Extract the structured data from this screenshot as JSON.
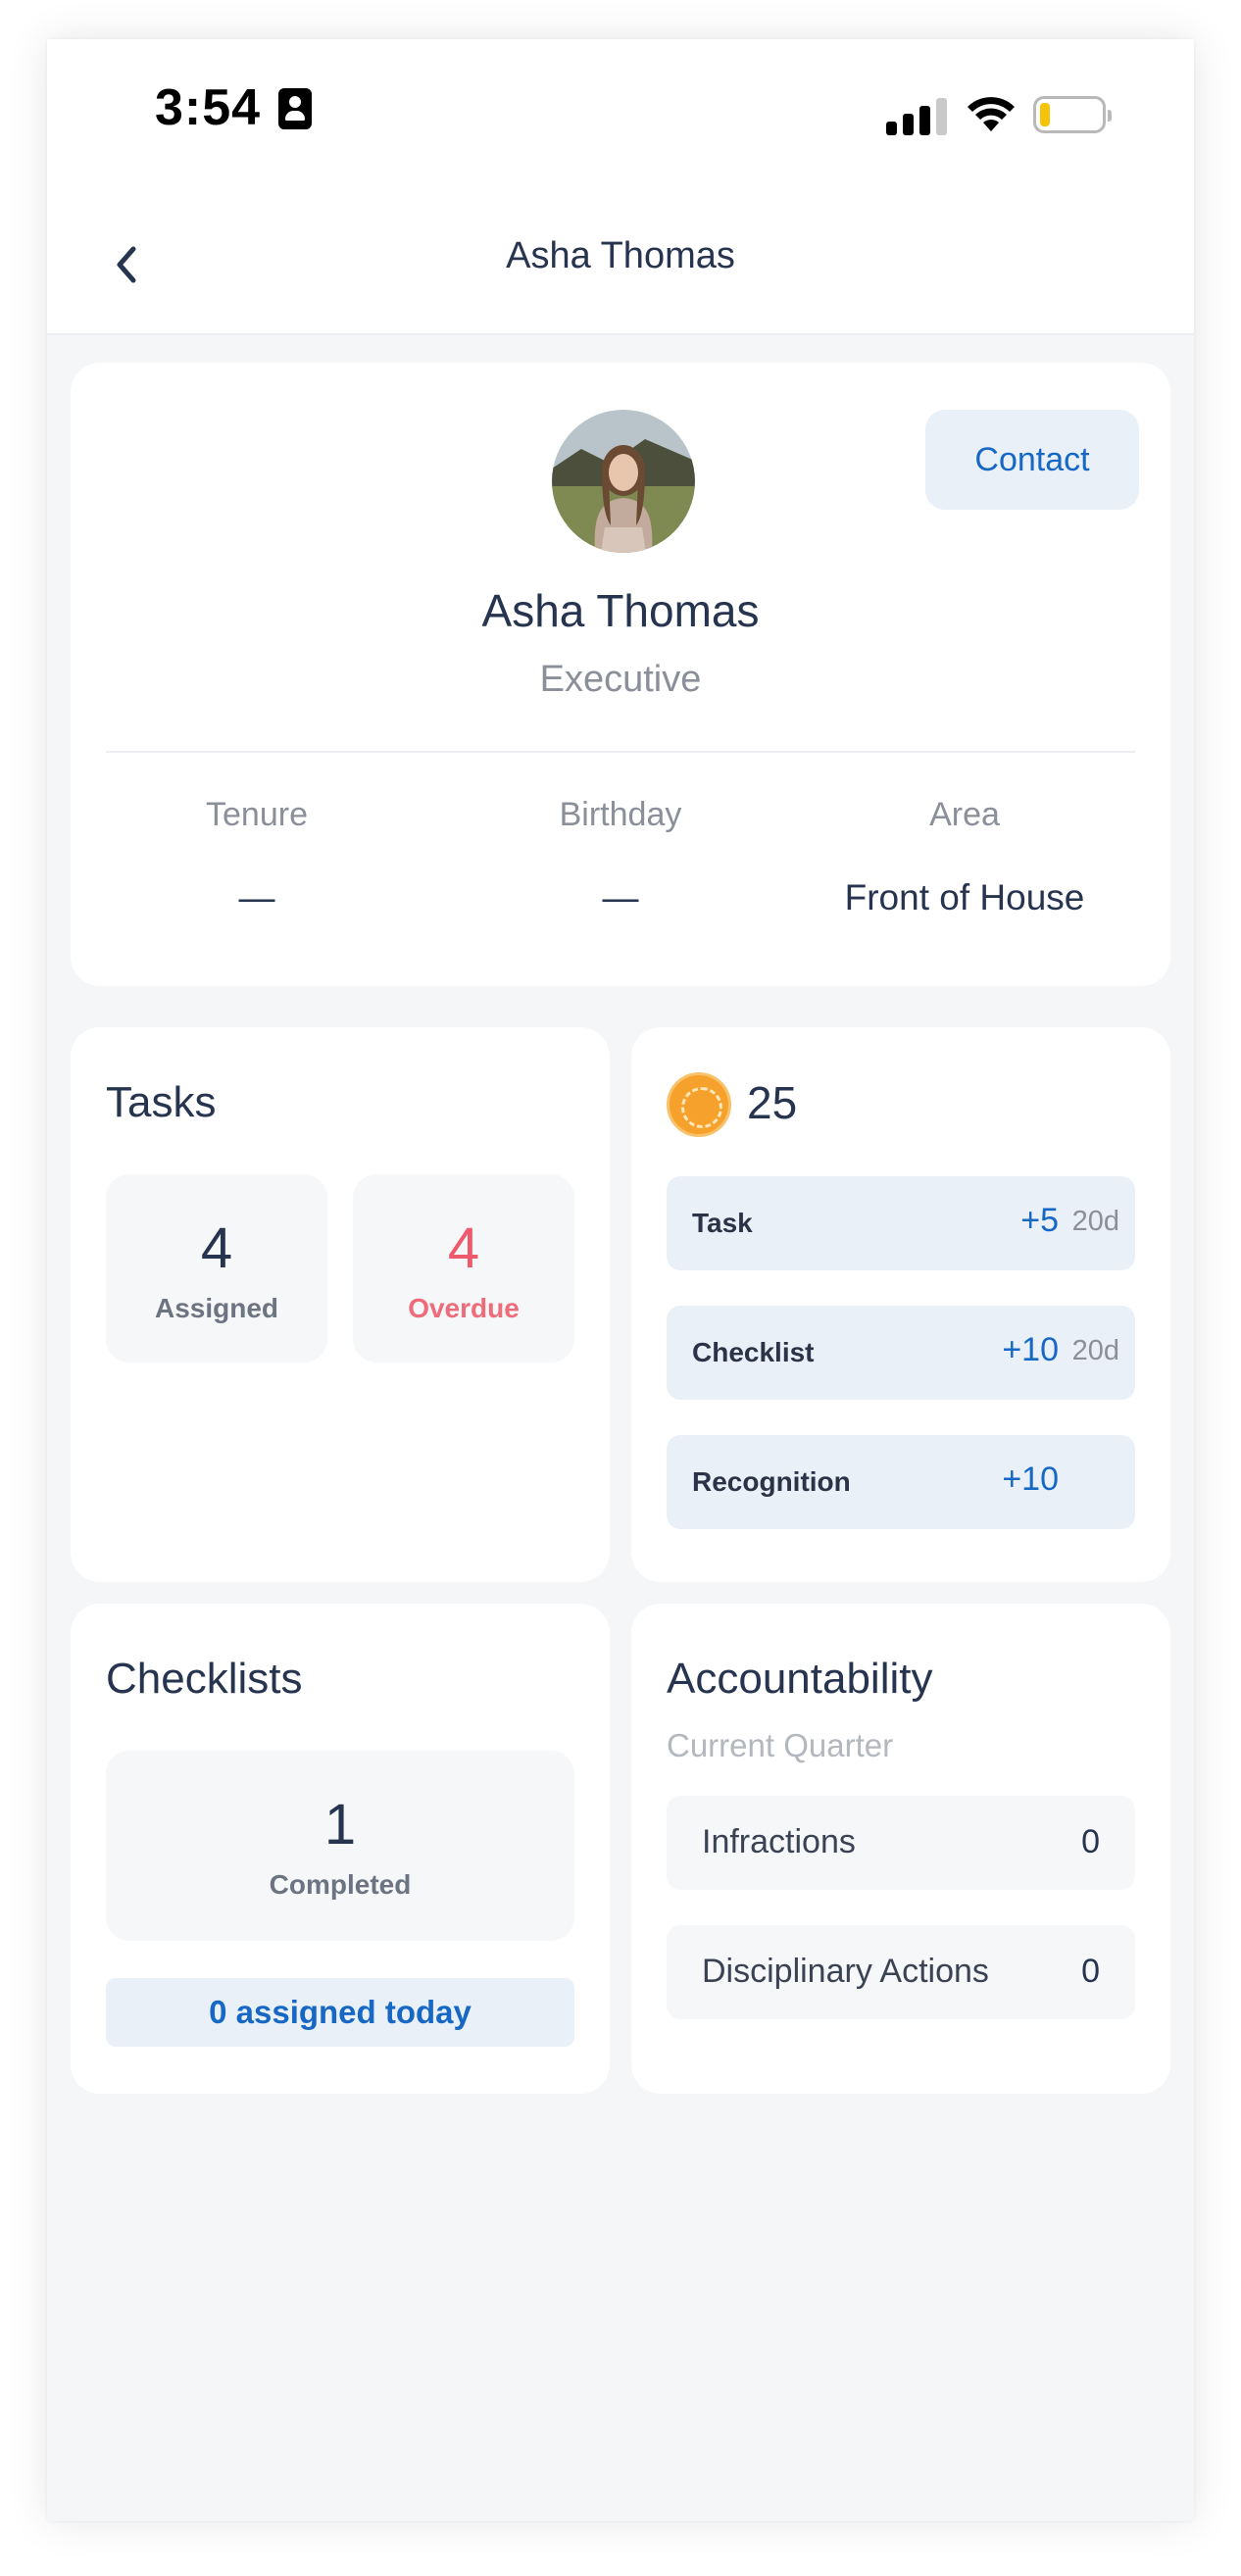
{
  "status_bar": {
    "time": "3:54",
    "battery_color": "#f4c40b"
  },
  "header": {
    "title": "Asha Thomas"
  },
  "profile": {
    "name": "Asha Thomas",
    "role": "Executive",
    "contact_label": "Contact",
    "stats": [
      {
        "label": "Tenure",
        "value": "—"
      },
      {
        "label": "Birthday",
        "value": "—"
      },
      {
        "label": "Area",
        "value": "Front of House"
      }
    ]
  },
  "tasks": {
    "title": "Tasks",
    "assigned": {
      "value": "4",
      "label": "Assigned"
    },
    "overdue": {
      "value": "4",
      "label": "Overdue"
    }
  },
  "points": {
    "total": "25",
    "items": [
      {
        "label": "Task",
        "points": "+5",
        "age": "20d"
      },
      {
        "label": "Checklist",
        "points": "+10",
        "age": "20d"
      },
      {
        "label": "Recognition",
        "points": "+10",
        "age": ""
      }
    ]
  },
  "checklists": {
    "title": "Checklists",
    "completed": {
      "value": "1",
      "label": "Completed"
    },
    "assigned_today": "0 assigned today"
  },
  "accountability": {
    "title": "Accountability",
    "subtitle": "Current Quarter",
    "rows": [
      {
        "label": "Infractions",
        "value": "0"
      },
      {
        "label": "Disciplinary Actions",
        "value": "0"
      }
    ]
  },
  "colors": {
    "accent": "#1668c4",
    "overdue": "#ee5a6b",
    "background": "#f5f6f8",
    "chip_bg": "#e9f0f8"
  }
}
